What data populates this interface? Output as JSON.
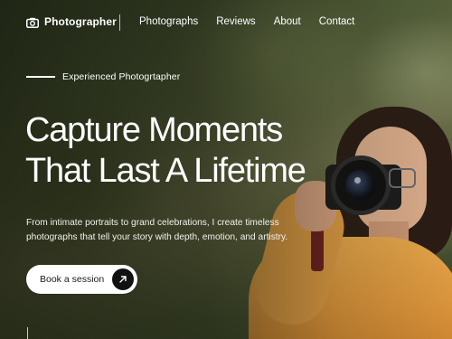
{
  "brand": {
    "name": "Photographer",
    "icon": "camera-icon"
  },
  "nav": {
    "items": [
      {
        "label": "Photographs"
      },
      {
        "label": "Reviews"
      },
      {
        "label": "About"
      },
      {
        "label": "Contact"
      }
    ]
  },
  "hero": {
    "eyebrow": "Experienced Photogrtapher",
    "headline_line1": "Capture Moments",
    "headline_line2": "That Last A Lifetime",
    "subcopy": "From intimate portraits to grand celebrations, I create timeless photographs that tell your story with depth, emotion, and artistry.",
    "cta_label": "Book a session",
    "cta_icon": "arrow-up-right-icon"
  },
  "colors": {
    "cta_bg": "#ffffff",
    "cta_arrow_bg": "#111111",
    "sweater": "#e4a54a"
  }
}
